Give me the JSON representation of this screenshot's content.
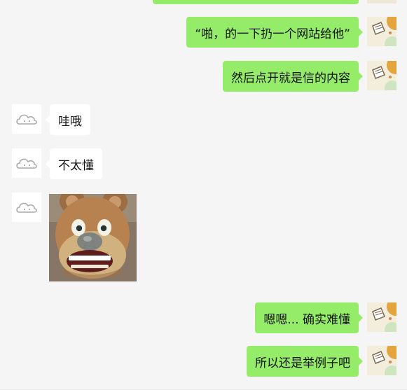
{
  "chat": {
    "messages": [
      {
        "side": "right",
        "text": "“啪，的一下扔一个网站给他”",
        "avatar": "user-avatar"
      },
      {
        "side": "right",
        "text": "然后点开就是信的内容",
        "avatar": "user-avatar"
      },
      {
        "side": "left",
        "text": "哇哦",
        "avatar": "cloud-avatar"
      },
      {
        "side": "left",
        "text": "不太懂",
        "avatar": "cloud-avatar"
      },
      {
        "side": "left",
        "type": "sticker",
        "sticker": "bear-sticker",
        "avatar": "cloud-avatar"
      },
      {
        "side": "right",
        "text": "嗯嗯... 确实难懂",
        "avatar": "user-avatar"
      },
      {
        "side": "right",
        "text": "所以还是举例子吧",
        "avatar": "user-avatar"
      }
    ]
  },
  "colors": {
    "background": "#f5f5f5",
    "sent_bubble": "#95ec69",
    "received_bubble": "#ffffff",
    "text": "#111111"
  }
}
